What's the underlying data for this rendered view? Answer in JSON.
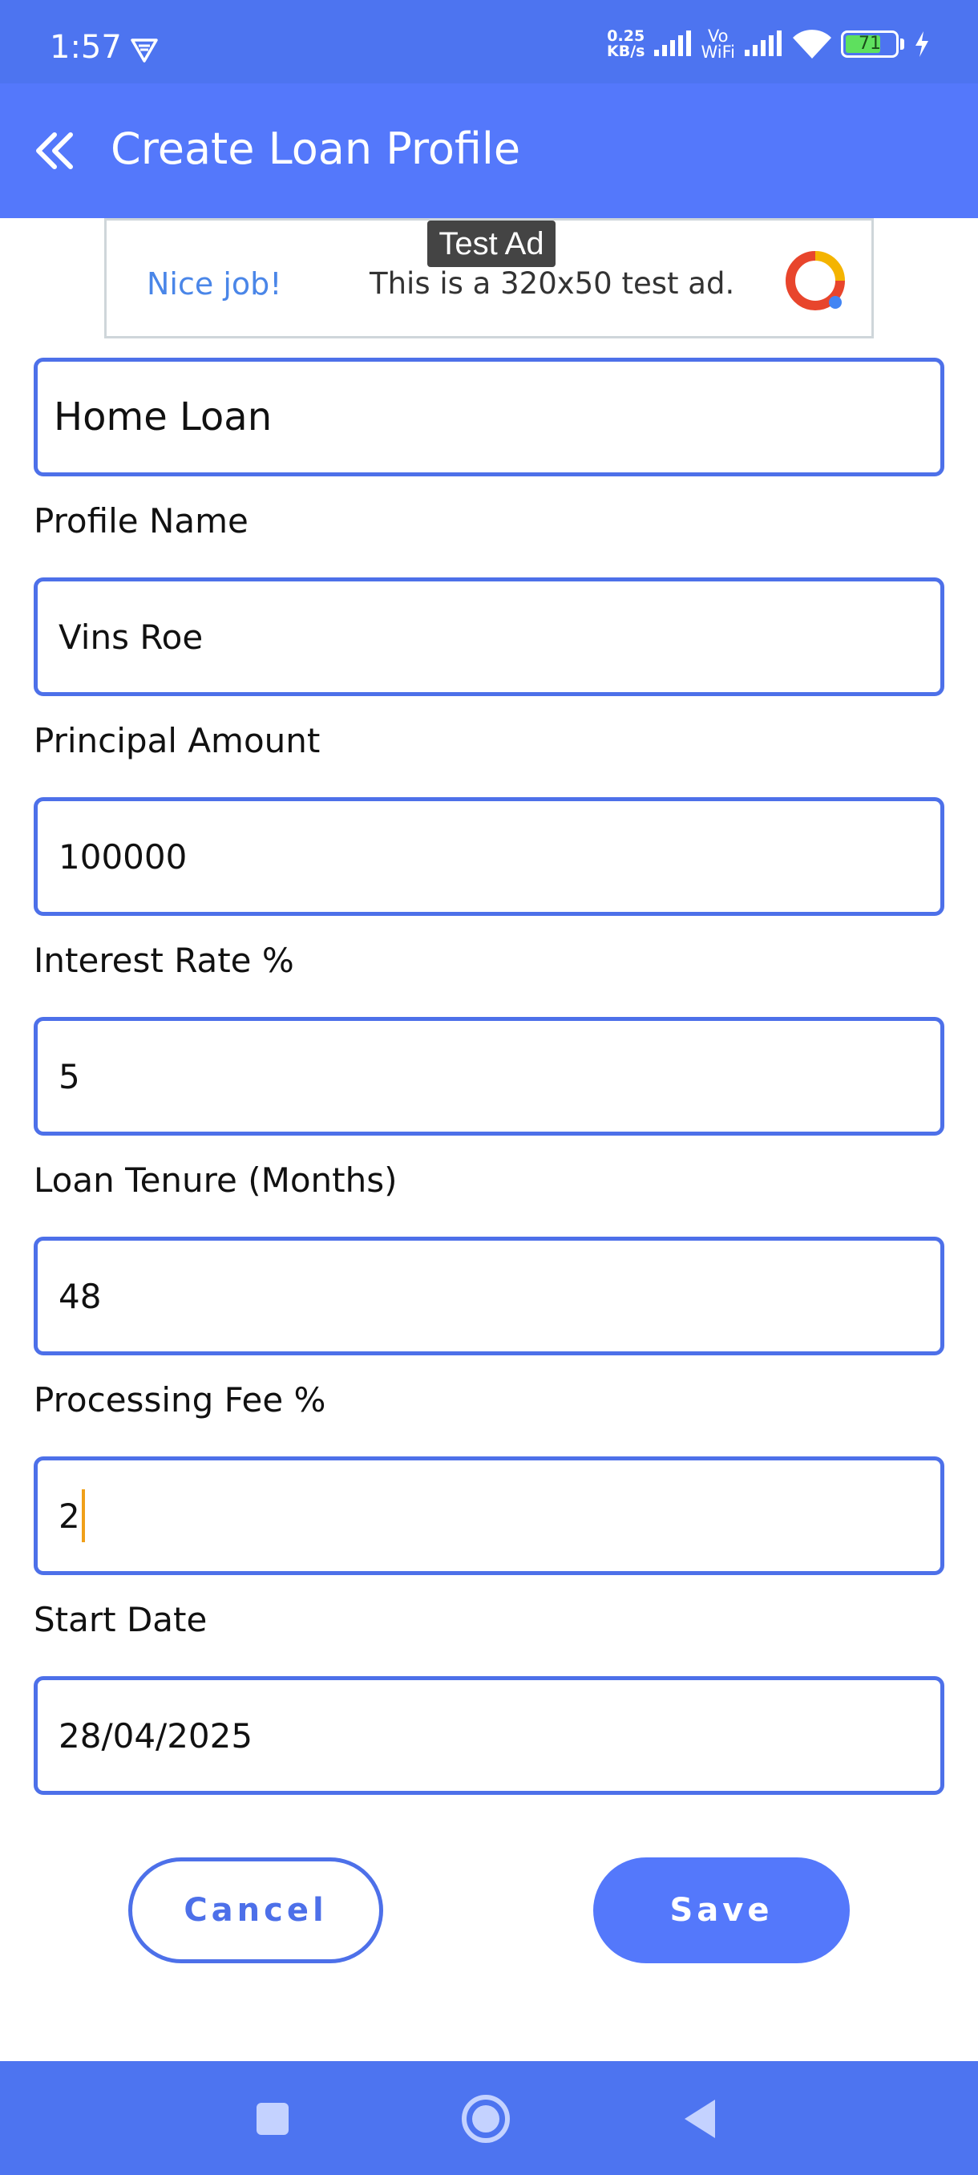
{
  "status_bar": {
    "time": "1:57",
    "net_speed_value": "0.25",
    "net_speed_unit": "KB/s",
    "vowifi_top": "Vo",
    "vowifi_bottom": "WiFi",
    "battery": "71",
    "icons": [
      "vpn-icon",
      "signal-icon",
      "wifi-icon",
      "battery-icon",
      "charging-icon"
    ]
  },
  "app_bar": {
    "title": "Create Loan Profile",
    "back_icon": "double-chevron-left-icon"
  },
  "ad": {
    "tag": "Test Ad",
    "headline": "Nice job!",
    "description": "This is a 320x50 test ad."
  },
  "form": {
    "loan_type": {
      "value": "Home Loan"
    },
    "fields": [
      {
        "label": "Profile Name",
        "value": "Vins Roe"
      },
      {
        "label": "Principal Amount",
        "value": "100000"
      },
      {
        "label": "Interest Rate %",
        "value": "5"
      },
      {
        "label": "Loan Tenure (Months)",
        "value": "48"
      },
      {
        "label": "Processing Fee %",
        "value": "2"
      },
      {
        "label": "Start Date",
        "value": "28/04/2025"
      }
    ]
  },
  "actions": {
    "cancel_label": "Cancel",
    "save_label": "Save"
  },
  "colors": {
    "primary": "#5478fb",
    "border": "#4d70e9",
    "caret": "#f0a019"
  },
  "nav_bar": {
    "icons": [
      "recents-square-icon",
      "home-circle-icon",
      "back-triangle-icon"
    ]
  }
}
